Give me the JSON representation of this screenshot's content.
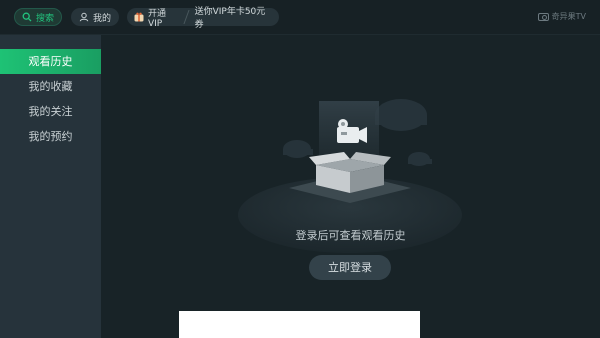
{
  "topbar": {
    "search_label": "搜索",
    "mine_label": "我的",
    "vip_label": "开通VIP",
    "vip_promo": "送你VIP年卡50元券",
    "logo_text": "奇异果TV"
  },
  "sidebar": {
    "items": [
      {
        "label": "观看历史",
        "active": true
      },
      {
        "label": "我的收藏",
        "active": false
      },
      {
        "label": "我的关注",
        "active": false
      },
      {
        "label": "我的预约",
        "active": false
      }
    ]
  },
  "main": {
    "empty_message": "登录后可查看观看历史",
    "login_button": "立即登录"
  },
  "colors": {
    "accent": "#1fb36b",
    "background": "#172125",
    "sidebar": "#26333b"
  },
  "icons": [
    "search-icon",
    "user-icon",
    "vip-gift-icon",
    "tv-camera-logo-icon",
    "empty-box-illustration"
  ]
}
